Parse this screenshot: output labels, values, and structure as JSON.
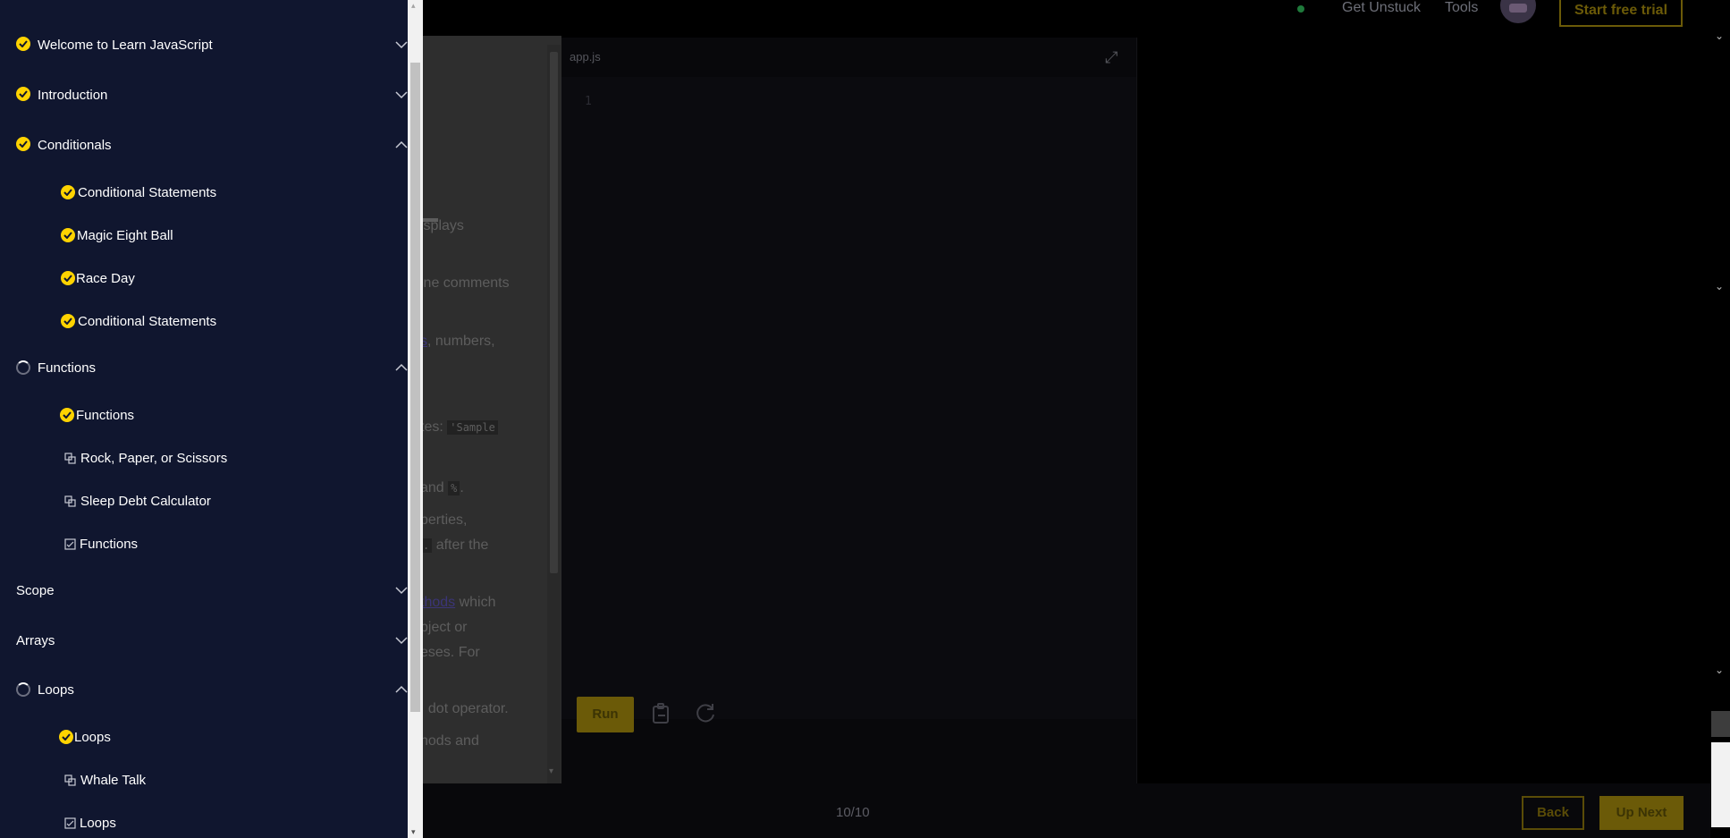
{
  "header": {
    "get_unstuck": "Get Unstuck",
    "tools": "Tools",
    "start_trial": "Start free trial"
  },
  "sidebar": {
    "modules": [
      {
        "label": "Welcome to Learn JavaScript",
        "status": "complete",
        "expanded": false
      },
      {
        "label": "Introduction",
        "status": "complete",
        "expanded": false
      },
      {
        "label": "Conditionals",
        "status": "complete",
        "expanded": true,
        "items": [
          {
            "label": "Conditional Statements",
            "type": "lesson",
            "status": "complete"
          },
          {
            "label": "Magic Eight Ball",
            "type": "lesson",
            "status": "complete"
          },
          {
            "label": "Race Day",
            "type": "lesson",
            "status": "complete"
          },
          {
            "label": "Conditional Statements",
            "type": "lesson",
            "status": "complete"
          }
        ]
      },
      {
        "label": "Functions",
        "status": "in-progress",
        "expanded": true,
        "items": [
          {
            "label": "Functions",
            "type": "lesson",
            "status": "complete"
          },
          {
            "label": "Rock, Paper, or Scissors",
            "type": "project",
            "status": "incomplete"
          },
          {
            "label": "Sleep Debt Calculator",
            "type": "project",
            "status": "incomplete"
          },
          {
            "label": "Functions",
            "type": "quiz",
            "status": "incomplete"
          }
        ]
      },
      {
        "label": "Scope",
        "status": "none",
        "expanded": false
      },
      {
        "label": "Arrays",
        "status": "none",
        "expanded": false
      },
      {
        "label": "Loops",
        "status": "in-progress",
        "expanded": true,
        "items": [
          {
            "label": "Loops",
            "type": "lesson",
            "status": "complete"
          },
          {
            "label": "Whale Talk",
            "type": "project",
            "status": "incomplete"
          },
          {
            "label": "Loops",
            "type": "quiz",
            "status": "incomplete"
          }
        ]
      }
    ]
  },
  "lesson": {
    "lines": {
      "l1": "isplays",
      "l2": "ine comments",
      "l3_link": "s",
      "l3_rest": ", numbers,",
      "l4_text": "tes:",
      "l4_code": "'Sample",
      "l5_text": "and",
      "l5_code": "%",
      "l5_end": ".",
      "l6": "perties,",
      "l7_code": ".",
      "l7_text": "after the",
      "l8_link": "thods",
      "l8_rest": " which",
      "l9": "bject or",
      "l10": "eses. For",
      "l11": ", dot operator.",
      "l12": "hods and"
    }
  },
  "editor": {
    "tab": "app.js",
    "line_number": "1",
    "run": "Run"
  },
  "footer": {
    "progress": "10/10",
    "back": "Back",
    "next": "Up Next"
  },
  "colors": {
    "sidebar_bg": "#10162f",
    "check": "#ffd300",
    "accent_dimmed": "#6b5a08"
  },
  "icons": {
    "check": "check-circle-icon",
    "spinner": "in-progress-icon",
    "project": "project-icon",
    "quiz": "quiz-icon",
    "chevron_up": "chevron-up-icon",
    "chevron_down": "chevron-down-icon"
  }
}
